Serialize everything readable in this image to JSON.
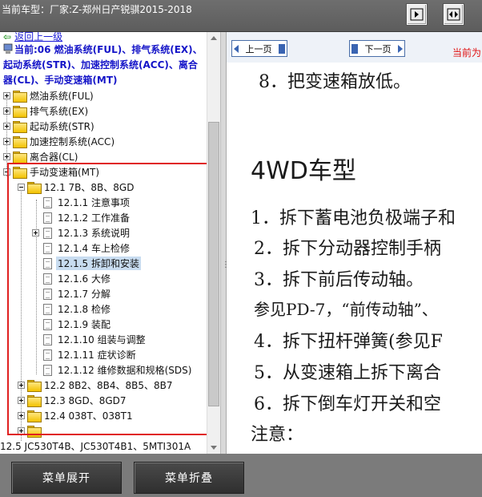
{
  "header": {
    "title": "当前车型：厂家:Z-郑州日产锐骐2015-2018"
  },
  "tree": {
    "back_link": "返回上一级",
    "current": "当前:06 燃油系统(FUL)、排气系统(EX)、起动系统(STR)、加速控制系统(ACC)、离合器(CL)、手动变速箱(MT)",
    "top_items": [
      "燃油系统(FUL)",
      "排气系统(EX)",
      "起动系统(STR)",
      "加速控制系统(ACC)",
      "离合器(CL)"
    ],
    "mt": "手动变速箱(MT)",
    "group1": "12.1 7B、8B、8GD",
    "group1_children": [
      {
        "label": "12.1.1 注意事项",
        "expandable": false
      },
      {
        "label": "12.1.2 工作准备",
        "expandable": false
      },
      {
        "label": "12.1.3 系统说明",
        "expandable": true
      },
      {
        "label": "12.1.4 车上检修",
        "expandable": false
      },
      {
        "label": "12.1.5 拆卸和安装",
        "expandable": false,
        "selected": true
      },
      {
        "label": "12.1.6 大修",
        "expandable": false
      },
      {
        "label": "12.1.7 分解",
        "expandable": false
      },
      {
        "label": "12.1.8 检修",
        "expandable": false
      },
      {
        "label": "12.1.9 装配",
        "expandable": false
      },
      {
        "label": "12.1.10 组装与调整",
        "expandable": false
      },
      {
        "label": "12.1.11 症状诊断",
        "expandable": false
      },
      {
        "label": "12.1.12 维修数据和规格(SDS)",
        "expandable": false
      }
    ],
    "other_groups": [
      "12.2 8B2、8B4、8B5、8B7",
      "12.3 8GD、8GD7",
      "12.4 038T、038T1"
    ],
    "bottom_item": "12.5 JC530T4B、JC530T4B1、5MTI301A"
  },
  "nav": {
    "prev": "上一页",
    "next": "下一页",
    "current_tag": "当前为"
  },
  "doc": {
    "line0": "8．把变速箱放低。",
    "heading": "4WD车型",
    "lines": [
      "1．拆下蓄电池负极端子和",
      "2．拆下分动器控制手柄",
      "3．拆下前后传动轴。",
      "参见PD-7，“前传动轴”、",
      "4．拆下扭杆弹簧(参见F",
      "5．从变速箱上拆下离合",
      "6．拆下倒车灯开关和空",
      "注意："
    ]
  },
  "footer": {
    "expand": "菜单展开",
    "collapse": "菜单折叠"
  }
}
